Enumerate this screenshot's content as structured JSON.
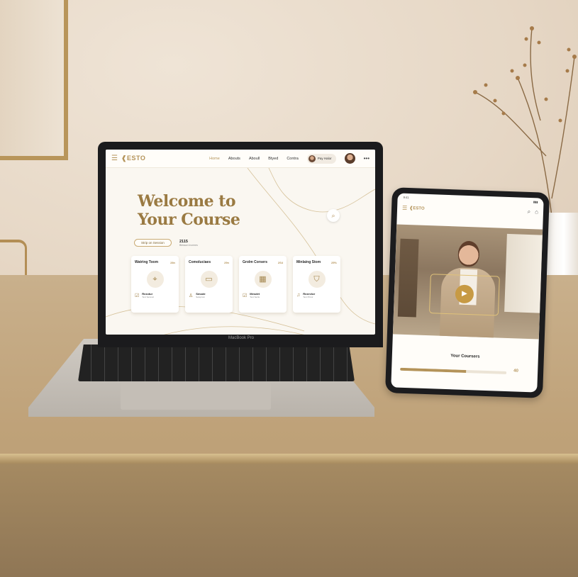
{
  "laptop": {
    "brand_label": "MacBook Pro",
    "nav": {
      "logo": "ESTO",
      "links": [
        {
          "label": "Home",
          "active": true
        },
        {
          "label": "Abouts",
          "active": false
        },
        {
          "label": "Aboull",
          "active": false
        },
        {
          "label": "Btyed",
          "active": false
        },
        {
          "label": "Contra",
          "active": false
        }
      ],
      "profile_label": "Pay Halor"
    },
    "hero": {
      "title_line1": "Welcome to",
      "title_line2": "Your Course",
      "enroll_label": "Strip on Session",
      "stat_number": "2115",
      "stat_label": "Blesson Incrmes"
    },
    "cards": [
      {
        "title": "Watring Toom",
        "percent": "28n",
        "icon": "location-pin-icon",
        "foot_icon": "checkbox-icon",
        "foot_title": "Rezotur",
        "foot_sub": "Text Sezevic"
      },
      {
        "title": "Comoluciaes",
        "percent": "29n",
        "icon": "video-icon",
        "foot_icon": "user-icon",
        "foot_title": "Smode",
        "foot_sub": "Seluprom"
      },
      {
        "title": "Grolm Corsers",
        "percent": "2S4",
        "icon": "calendar-icon",
        "foot_icon": "checkbox-icon",
        "foot_title": "Mesdet",
        "foot_sub": "Text Sezle"
      },
      {
        "title": "Minlaing Stom",
        "percent": "25%",
        "icon": "shield-icon",
        "foot_icon": "bell-icon",
        "foot_title": "Rezevice",
        "foot_sub": "Text Pricur"
      }
    ]
  },
  "tablet": {
    "status_time": "9:41",
    "logo": "ESTO",
    "footer_title": "Your Coursers",
    "progress": 0.62,
    "progress_label": "40"
  },
  "colors": {
    "accent": "#b49359",
    "hero_title": "#9a7a42",
    "screen_bg": "#faf7f1"
  }
}
